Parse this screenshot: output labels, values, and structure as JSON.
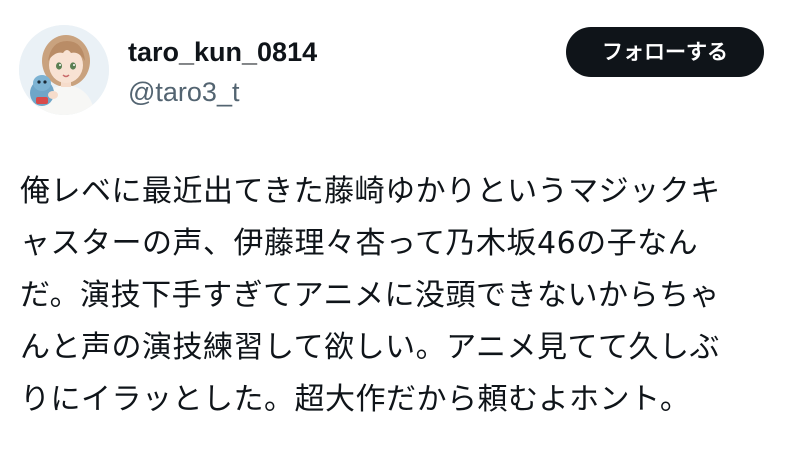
{
  "profile": {
    "display_name": "taro_kun_0814",
    "handle": "@taro3_t",
    "avatar_icon": "anime-girl-avatar-icon"
  },
  "follow_button": {
    "label": "フォローする"
  },
  "tweet": {
    "lines": [
      "俺レベに最近出てきた藤崎ゆかりというマジックキ",
      "ャスターの声、伊藤理々杏って乃木坂46の子なん",
      "だ。演技下手すぎてアニメに没頭できないからちゃ",
      "んと声の演技練習して欲しい。アニメ見てて久しぶ",
      "りにイラッとした。超大作だから頼むよホント。"
    ]
  },
  "colors": {
    "text": "#0f1419",
    "secondary_text": "#536471",
    "button_bg": "#0f1419",
    "button_text": "#ffffff",
    "background": "#ffffff"
  }
}
